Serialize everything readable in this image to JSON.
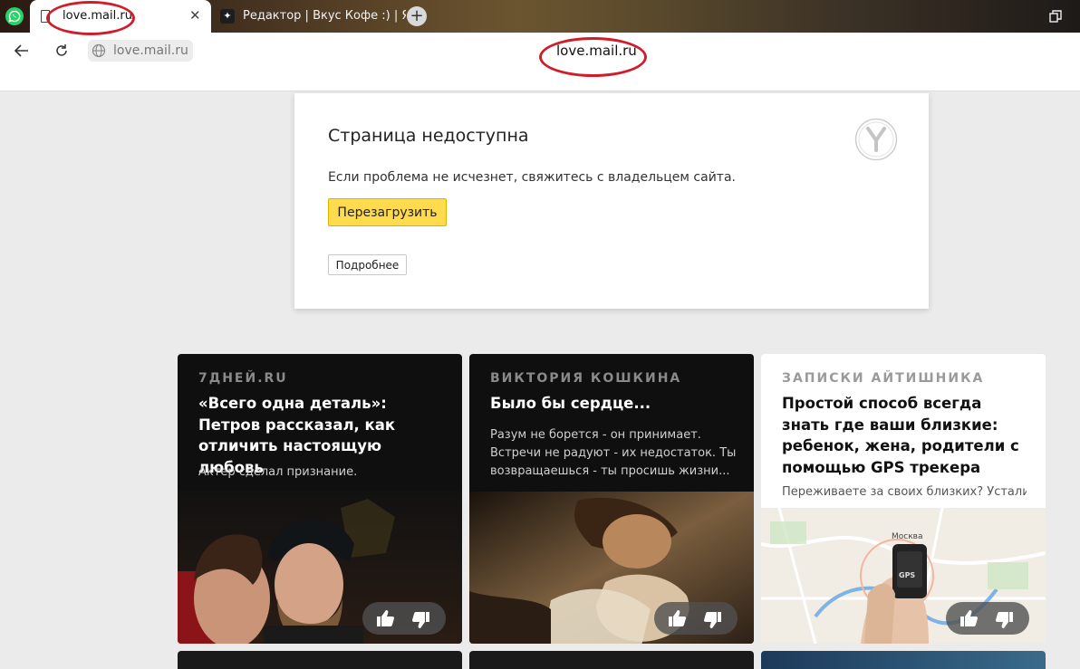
{
  "tabs": [
    {
      "title": "love.mail.ru",
      "active": true
    },
    {
      "title": "Редактор | Вкус Кофе :) | Я",
      "active": false
    }
  ],
  "address_bar": {
    "url": "love.mail.ru",
    "page_host": "love.mail.ru"
  },
  "error": {
    "title": "Страница недоступна",
    "description": "Если проблема не исчезнет, свяжитесь с владельцем сайта.",
    "reload_label": "Перезагрузить",
    "details_label": "Подробнее"
  },
  "feed": [
    {
      "source": "7ДНЕЙ.RU",
      "headline": "«Всего одна деталь»: Петров рассказал, как отличить настоящую любовь",
      "teaser": "Актер сделал признание."
    },
    {
      "source": "ВИКТОРИЯ КОШКИНА",
      "headline": "Было бы сердце...",
      "teaser": "Разум не борется - он принимает. Встречи не радуют - их недостаток. Ты возвращаешься - ты просишь жизни..."
    },
    {
      "source": "ЗАПИСКИ АЙТИШНИКА",
      "headline": "Простой способ всегда знать где ваши близкие: ребенок, жена, родители с помощью GPS трекера",
      "teaser": "Переживаете за своих близких? Устали...",
      "device_label": "GPS",
      "map_label": "Москва"
    }
  ],
  "colors": {
    "annotation": "#d01d2a",
    "reload_button": "#ffdb4d"
  }
}
